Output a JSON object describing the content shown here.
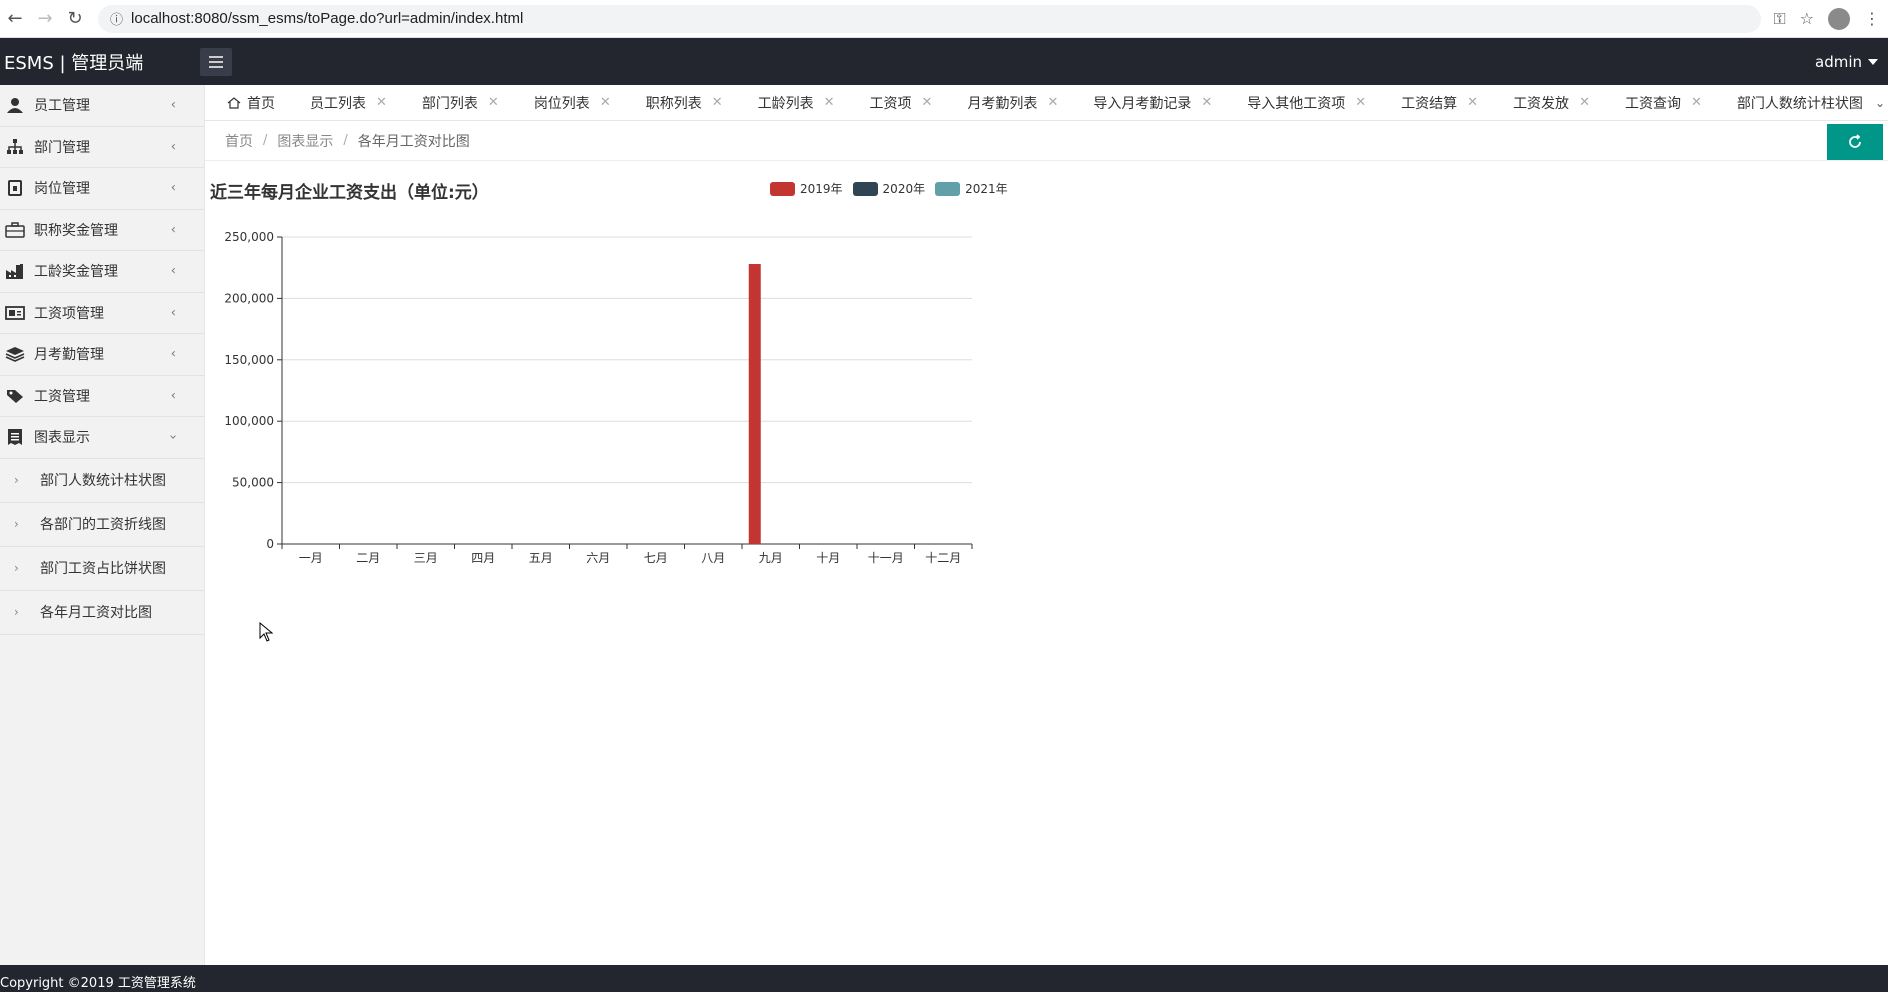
{
  "browser": {
    "url": "localhost:8080/ssm_esms/toPage.do?url=admin/index.html"
  },
  "header": {
    "brand": "ESMS | 管理员端",
    "user": "admin"
  },
  "sidebar": {
    "items": [
      {
        "label": "员工管理",
        "icon": "user-icon"
      },
      {
        "label": "部门管理",
        "icon": "org-chart-icon"
      },
      {
        "label": "岗位管理",
        "icon": "badge-icon"
      },
      {
        "label": "职称奖金管理",
        "icon": "briefcase-icon"
      },
      {
        "label": "工龄奖金管理",
        "icon": "factory-icon"
      },
      {
        "label": "工资项管理",
        "icon": "id-card-icon"
      },
      {
        "label": "月考勤管理",
        "icon": "layers-icon"
      },
      {
        "label": "工资管理",
        "icon": "tag-icon"
      },
      {
        "label": "图表显示",
        "icon": "receipt-icon"
      }
    ],
    "subitems": [
      {
        "label": "部门人数统计柱状图"
      },
      {
        "label": "各部门的工资折线图"
      },
      {
        "label": "部门工资占比饼状图"
      },
      {
        "label": "各年月工资对比图"
      }
    ]
  },
  "tabs": [
    {
      "label": "首页"
    },
    {
      "label": "员工列表"
    },
    {
      "label": "部门列表"
    },
    {
      "label": "岗位列表"
    },
    {
      "label": "职称列表"
    },
    {
      "label": "工龄列表"
    },
    {
      "label": "工资项"
    },
    {
      "label": "月考勤列表"
    },
    {
      "label": "导入月考勤记录"
    },
    {
      "label": "导入其他工资项"
    },
    {
      "label": "工资结算"
    },
    {
      "label": "工资发放"
    },
    {
      "label": "工资查询"
    },
    {
      "label": "部门人数统计柱状图"
    }
  ],
  "breadcrumb": [
    "首页",
    "图表显示",
    "各年月工资对比图"
  ],
  "chart_data": {
    "type": "bar",
    "title": "近三年每月企业工资支出（单位:元）",
    "categories": [
      "一月",
      "二月",
      "三月",
      "四月",
      "五月",
      "六月",
      "七月",
      "八月",
      "九月",
      "十月",
      "十一月",
      "十二月"
    ],
    "series": [
      {
        "name": "2019年",
        "color": "#c23531",
        "values": [
          0,
          0,
          0,
          0,
          0,
          0,
          0,
          0,
          228000,
          0,
          0,
          0
        ]
      },
      {
        "name": "2020年",
        "color": "#2f4554",
        "values": [
          0,
          0,
          0,
          0,
          0,
          0,
          0,
          0,
          0,
          0,
          0,
          0
        ]
      },
      {
        "name": "2021年",
        "color": "#61a0a8",
        "values": [
          0,
          0,
          0,
          0,
          0,
          0,
          0,
          0,
          0,
          0,
          0,
          0
        ]
      }
    ],
    "yticks": [
      "250,000",
      "200,000",
      "150,000",
      "100,000",
      "50,000",
      "0"
    ],
    "ylim": [
      0,
      250000
    ],
    "grid": true,
    "legend": "top"
  },
  "footer": {
    "text": "Copyright ©2019 工资管理系统"
  }
}
